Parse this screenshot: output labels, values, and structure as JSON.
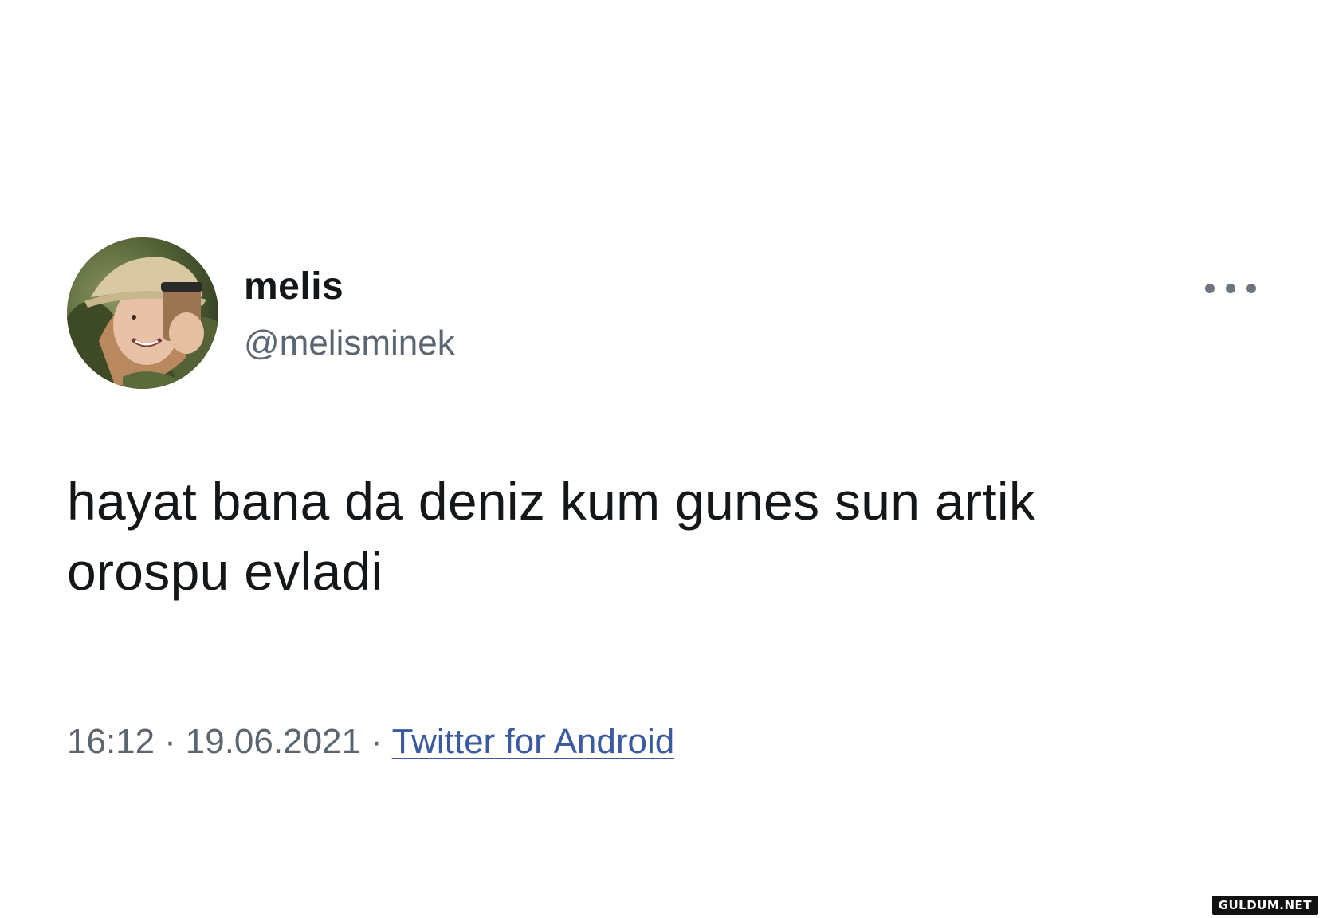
{
  "tweet": {
    "author": {
      "name": "melis",
      "handle": "@melisminek"
    },
    "text_lines": [
      "hayat bana da deniz kum gunes sun artik",
      "orospu evladi"
    ],
    "time": "16:12",
    "separator": "·",
    "date": "19.06.2021",
    "source": "Twitter for Android",
    "more_icon": "more-horizontal-icon"
  },
  "watermark": {
    "text": "GULDUM.NET"
  },
  "colors": {
    "text": "#14171a",
    "secondary": "#5b6670",
    "link": "#3b5aa0",
    "background": "#ffffff"
  }
}
